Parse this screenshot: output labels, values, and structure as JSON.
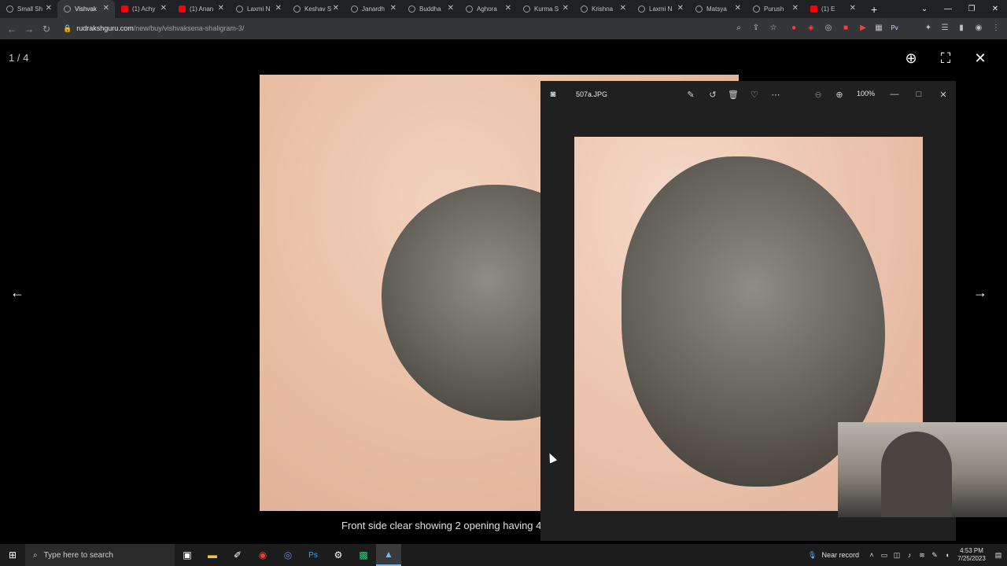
{
  "browser": {
    "tabs": [
      {
        "label": "Small Sh",
        "favicon": "globe-icon"
      },
      {
        "label": "Vishvak",
        "favicon": "globe-icon",
        "active": true
      },
      {
        "label": "(1) Achy",
        "favicon": "youtube-icon"
      },
      {
        "label": "(1) Anan",
        "favicon": "youtube-icon"
      },
      {
        "label": "Laxmi N",
        "favicon": "globe-icon"
      },
      {
        "label": "Keshav S",
        "favicon": "globe-icon"
      },
      {
        "label": "Janardh",
        "favicon": "globe-icon"
      },
      {
        "label": "Buddha",
        "favicon": "globe-icon"
      },
      {
        "label": "Aghora",
        "favicon": "globe-icon"
      },
      {
        "label": "Kurma S",
        "favicon": "globe-icon"
      },
      {
        "label": "Krishna",
        "favicon": "globe-icon"
      },
      {
        "label": "Laxmi N",
        "favicon": "globe-icon"
      },
      {
        "label": "Matsya",
        "favicon": "globe-icon"
      },
      {
        "label": "Purush",
        "favicon": "globe-icon"
      },
      {
        "label": "(1) E",
        "favicon": "youtube-icon"
      }
    ],
    "url_domain": "rudrakshguru.com",
    "url_path": "/new/buy/vishvaksena-shaligram-3/"
  },
  "lightbox": {
    "counter": "1 / 4",
    "caption": "Front side clear showing 2 opening having 4"
  },
  "photos_app": {
    "filename": "507a.JPG",
    "zoom": "100%"
  },
  "taskbar": {
    "search_placeholder": "Type here to search",
    "recording_label": "Near record",
    "time": "4:53 PM",
    "date": "7/25/2023"
  },
  "colors": {
    "accent": "#76b9ed",
    "youtube_red": "#ff0000"
  }
}
